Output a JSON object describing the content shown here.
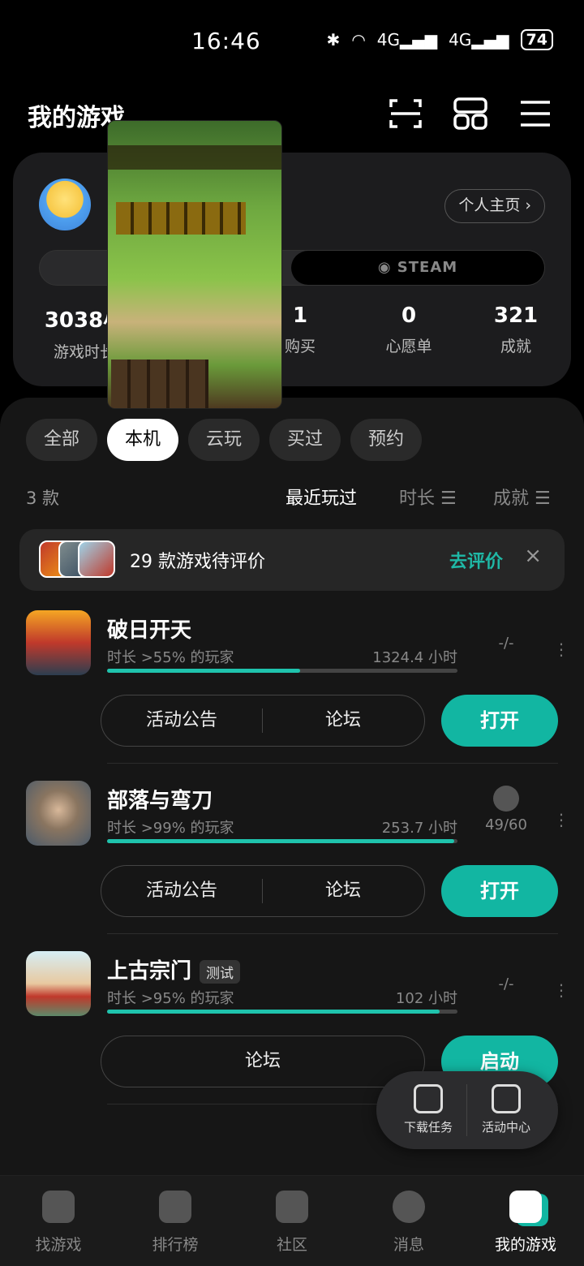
{
  "status_bar": {
    "time": "16:46",
    "network1": "4G",
    "network2": "4G",
    "battery": "74"
  },
  "header": {
    "title": "我的游戏"
  },
  "profile": {
    "homepage_label": "个人主页",
    "steam_label": "STEAM",
    "stats": [
      {
        "value": "3038小",
        "label": "游戏时长"
      },
      {
        "value": "1",
        "label": "购买"
      },
      {
        "value": "0",
        "label": "心愿单"
      },
      {
        "value": "321",
        "label": "成就"
      }
    ]
  },
  "filters": [
    "全部",
    "本机",
    "云玩",
    "买过",
    "预约"
  ],
  "active_filter": "本机",
  "count_label": "3 款",
  "sort_options": [
    "最近玩过",
    "时长",
    "成就"
  ],
  "review_banner": {
    "text": "29 款游戏待评价",
    "link": "去评价",
    "close": "×"
  },
  "games": [
    {
      "name": "破日开天",
      "tag": "",
      "subtitle": "时长 >55% 的玩家",
      "hours": "1324.4 小时",
      "progress": 0.55,
      "achievement": "-/-",
      "buttons": [
        "活动公告",
        "论坛"
      ],
      "action": "打开"
    },
    {
      "name": "部落与弯刀",
      "tag": "",
      "subtitle": "时长 >99% 的玩家",
      "hours": "253.7 小时",
      "progress": 0.99,
      "achievement": "49/60",
      "buttons": [
        "活动公告",
        "论坛"
      ],
      "action": "打开"
    },
    {
      "name": "上古宗门",
      "tag": "测试",
      "subtitle": "时长 >95% 的玩家",
      "hours": "102 小时",
      "progress": 0.95,
      "achievement": "-/-",
      "buttons": [
        "论坛"
      ],
      "action": "启动"
    }
  ],
  "floating": {
    "download": "下载任务",
    "events": "活动中心"
  },
  "nav": [
    "找游戏",
    "排行榜",
    "社区",
    "消息",
    "我的游戏"
  ],
  "colors": {
    "accent": "#12b6a2",
    "background": "#000000",
    "panel": "#161616"
  }
}
